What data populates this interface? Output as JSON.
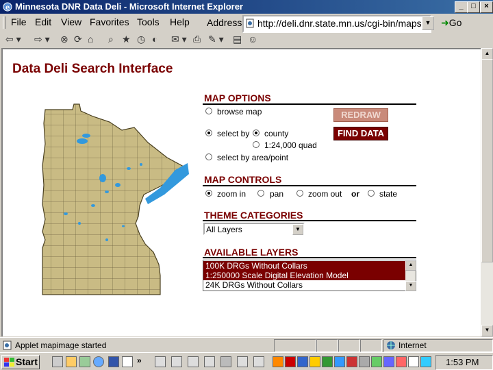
{
  "window": {
    "title": "Minnesota DNR Data Deli - Microsoft Internet Explorer",
    "min": "_",
    "max": "□",
    "close": "×"
  },
  "menu": {
    "items": [
      "File",
      "Edit",
      "View",
      "Favorites",
      "Tools",
      "Help"
    ]
  },
  "address": {
    "label": "Address",
    "url": "http://deli.dnr.state.mn.us/cgi-bin/mapser",
    "go": "Go"
  },
  "page": {
    "title": "Data Deli Search Interface",
    "map_options": {
      "heading": "MAP OPTIONS",
      "browse_map": "browse map",
      "select_by": "select by",
      "county": "county",
      "quad": "1:24,000 quad",
      "select_area": "select by area/point",
      "redraw": "REDRAW",
      "find_data": "FIND DATA"
    },
    "map_controls": {
      "heading": "MAP CONTROLS",
      "zoom_in": "zoom in",
      "pan": "pan",
      "zoom_out": "zoom out",
      "or": "or",
      "state": "state"
    },
    "theme": {
      "heading": "THEME CATEGORIES",
      "selected": "All Layers"
    },
    "layers": {
      "heading": "AVAILABLE LAYERS",
      "items": [
        "100K DRGs Without Collars",
        "1:250000 Scale Digital Elevation Model",
        "24K DRGs Without Collars"
      ]
    }
  },
  "status": {
    "message": "Applet mapimage started",
    "zone": "Internet"
  },
  "taskbar": {
    "start": "Start",
    "clock": "1:53 PM"
  },
  "colors": {
    "accent": "#7a0000",
    "map_land": "#c9bb84",
    "water": "#3399dd"
  }
}
